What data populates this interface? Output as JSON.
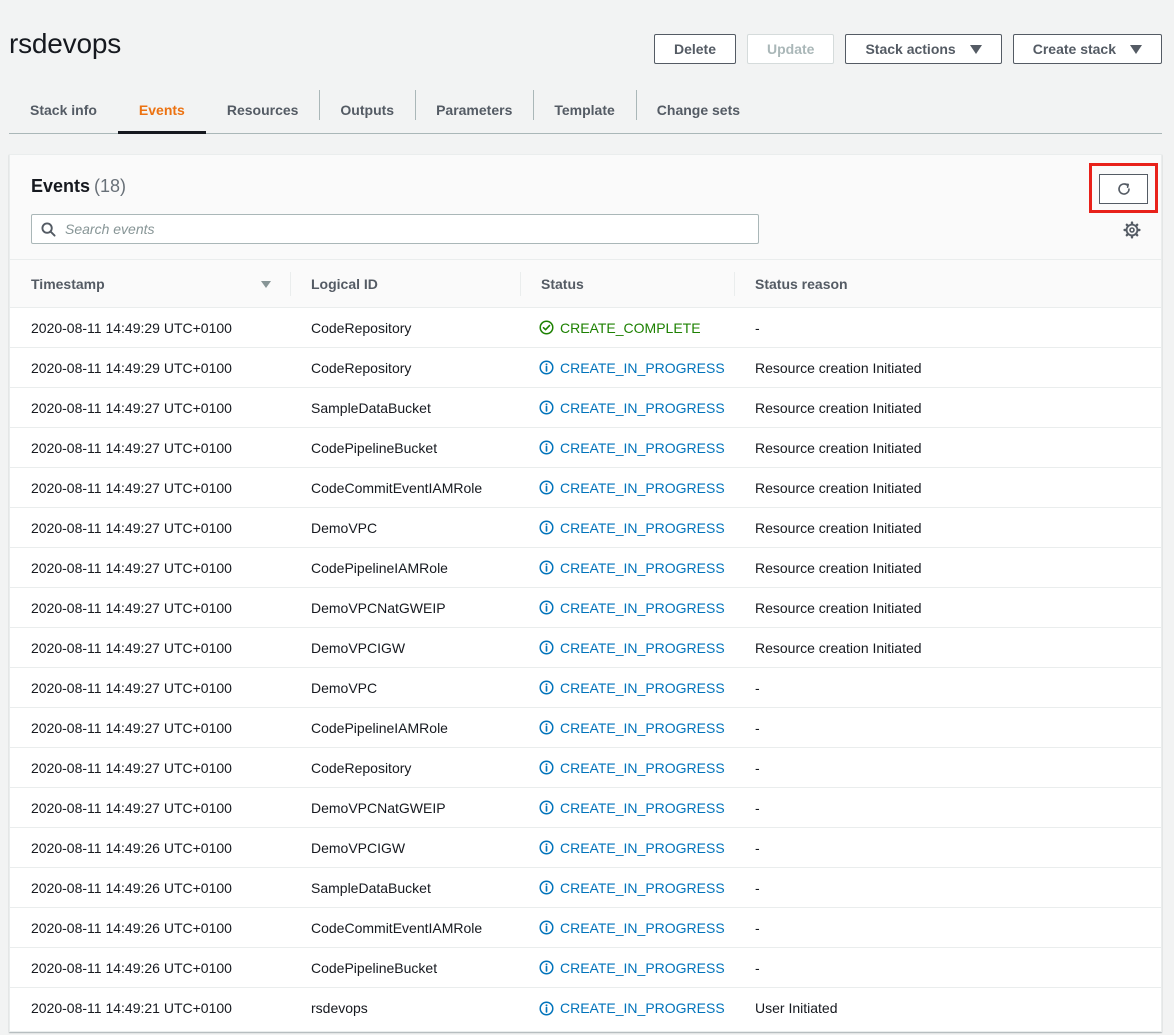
{
  "stack": {
    "name": "rsdevops"
  },
  "actions": {
    "delete": "Delete",
    "update": "Update",
    "stack_actions": "Stack actions",
    "create_stack": "Create stack"
  },
  "tabs": [
    {
      "label": "Stack info"
    },
    {
      "label": "Events"
    },
    {
      "label": "Resources"
    },
    {
      "label": "Outputs"
    },
    {
      "label": "Parameters"
    },
    {
      "label": "Template"
    },
    {
      "label": "Change sets"
    }
  ],
  "events_panel": {
    "title": "Events",
    "count": "(18)",
    "search_placeholder": "Search events",
    "columns": [
      "Timestamp",
      "Logical ID",
      "Status",
      "Status reason"
    ],
    "rows": [
      {
        "timestamp": "2020-08-11 14:49:29 UTC+0100",
        "logical_id": "CodeRepository",
        "status": "CREATE_COMPLETE",
        "reason": "-"
      },
      {
        "timestamp": "2020-08-11 14:49:29 UTC+0100",
        "logical_id": "CodeRepository",
        "status": "CREATE_IN_PROGRESS",
        "reason": "Resource creation Initiated"
      },
      {
        "timestamp": "2020-08-11 14:49:27 UTC+0100",
        "logical_id": "SampleDataBucket",
        "status": "CREATE_IN_PROGRESS",
        "reason": "Resource creation Initiated"
      },
      {
        "timestamp": "2020-08-11 14:49:27 UTC+0100",
        "logical_id": "CodePipelineBucket",
        "status": "CREATE_IN_PROGRESS",
        "reason": "Resource creation Initiated"
      },
      {
        "timestamp": "2020-08-11 14:49:27 UTC+0100",
        "logical_id": "CodeCommitEventIAMRole",
        "status": "CREATE_IN_PROGRESS",
        "reason": "Resource creation Initiated"
      },
      {
        "timestamp": "2020-08-11 14:49:27 UTC+0100",
        "logical_id": "DemoVPC",
        "status": "CREATE_IN_PROGRESS",
        "reason": "Resource creation Initiated"
      },
      {
        "timestamp": "2020-08-11 14:49:27 UTC+0100",
        "logical_id": "CodePipelineIAMRole",
        "status": "CREATE_IN_PROGRESS",
        "reason": "Resource creation Initiated"
      },
      {
        "timestamp": "2020-08-11 14:49:27 UTC+0100",
        "logical_id": "DemoVPCNatGWEIP",
        "status": "CREATE_IN_PROGRESS",
        "reason": "Resource creation Initiated"
      },
      {
        "timestamp": "2020-08-11 14:49:27 UTC+0100",
        "logical_id": "DemoVPCIGW",
        "status": "CREATE_IN_PROGRESS",
        "reason": "Resource creation Initiated"
      },
      {
        "timestamp": "2020-08-11 14:49:27 UTC+0100",
        "logical_id": "DemoVPC",
        "status": "CREATE_IN_PROGRESS",
        "reason": "-"
      },
      {
        "timestamp": "2020-08-11 14:49:27 UTC+0100",
        "logical_id": "CodePipelineIAMRole",
        "status": "CREATE_IN_PROGRESS",
        "reason": "-"
      },
      {
        "timestamp": "2020-08-11 14:49:27 UTC+0100",
        "logical_id": "CodeRepository",
        "status": "CREATE_IN_PROGRESS",
        "reason": "-"
      },
      {
        "timestamp": "2020-08-11 14:49:27 UTC+0100",
        "logical_id": "DemoVPCNatGWEIP",
        "status": "CREATE_IN_PROGRESS",
        "reason": "-"
      },
      {
        "timestamp": "2020-08-11 14:49:26 UTC+0100",
        "logical_id": "DemoVPCIGW",
        "status": "CREATE_IN_PROGRESS",
        "reason": "-"
      },
      {
        "timestamp": "2020-08-11 14:49:26 UTC+0100",
        "logical_id": "SampleDataBucket",
        "status": "CREATE_IN_PROGRESS",
        "reason": "-"
      },
      {
        "timestamp": "2020-08-11 14:49:26 UTC+0100",
        "logical_id": "CodeCommitEventIAMRole",
        "status": "CREATE_IN_PROGRESS",
        "reason": "-"
      },
      {
        "timestamp": "2020-08-11 14:49:26 UTC+0100",
        "logical_id": "CodePipelineBucket",
        "status": "CREATE_IN_PROGRESS",
        "reason": "-"
      },
      {
        "timestamp": "2020-08-11 14:49:21 UTC+0100",
        "logical_id": "rsdevops",
        "status": "CREATE_IN_PROGRESS",
        "reason": "User Initiated"
      }
    ]
  },
  "colors": {
    "accent_tab": "#ec7211",
    "status_complete": "#1d8102",
    "status_in_progress": "#0073bb",
    "highlight": "#e8211a"
  },
  "icons": {
    "refresh": "refresh-icon",
    "search": "search-icon",
    "settings": "gear-icon",
    "complete": "check-circle-icon",
    "in_progress": "info-circle-icon"
  }
}
